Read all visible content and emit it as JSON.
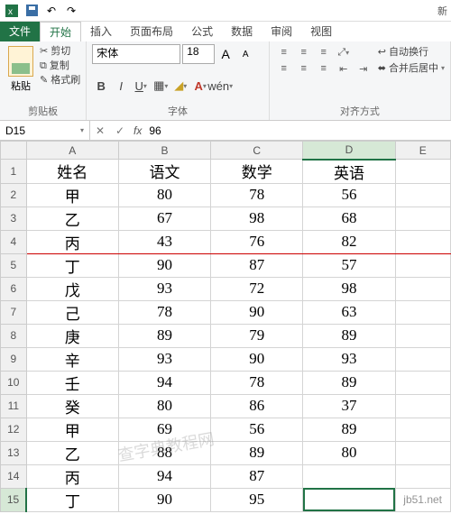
{
  "titlebar": {
    "new_label": "新"
  },
  "tabs": {
    "file": "文件",
    "home": "开始",
    "insert": "插入",
    "pagelayout": "页面布局",
    "formulas": "公式",
    "data": "数据",
    "review": "审阅",
    "view": "视图"
  },
  "ribbon": {
    "clipboard": {
      "paste": "粘贴",
      "cut": "剪切",
      "copy": "复制",
      "format_painter": "格式刷",
      "group": "剪贴板"
    },
    "font": {
      "name": "宋体",
      "size": "18",
      "incA": "A",
      "decA": "A",
      "group": "字体"
    },
    "align": {
      "wrap": "自动换行",
      "merge": "合并后居中",
      "group": "对齐方式"
    }
  },
  "namebox": {
    "ref": "D15",
    "fx": "fx",
    "value": "96"
  },
  "colheads": [
    "A",
    "B",
    "C",
    "D",
    "E"
  ],
  "rowheads": [
    "1",
    "2",
    "3",
    "4",
    "5",
    "6",
    "7",
    "8",
    "9",
    "10",
    "11",
    "12",
    "13",
    "14",
    "15"
  ],
  "chart_data": {
    "type": "table",
    "headers": [
      "姓名",
      "语文",
      "数学",
      "英语"
    ],
    "rows": [
      [
        "甲",
        "80",
        "78",
        "56"
      ],
      [
        "乙",
        "67",
        "98",
        "68"
      ],
      [
        "丙",
        "43",
        "76",
        "82"
      ],
      [
        "丁",
        "90",
        "87",
        "57"
      ],
      [
        "戊",
        "93",
        "72",
        "98"
      ],
      [
        "己",
        "78",
        "90",
        "63"
      ],
      [
        "庚",
        "89",
        "79",
        "89"
      ],
      [
        "辛",
        "93",
        "90",
        "93"
      ],
      [
        "壬",
        "94",
        "78",
        "89"
      ],
      [
        "癸",
        "80",
        "86",
        "37"
      ],
      [
        "甲",
        "69",
        "56",
        "89"
      ],
      [
        "乙",
        "88",
        "89",
        "80"
      ],
      [
        "丙",
        "94",
        "87",
        ""
      ],
      [
        "丁",
        "90",
        "95",
        ""
      ]
    ]
  },
  "watermark": {
    "site": "jb51.net",
    "text": "查字典教程网"
  }
}
